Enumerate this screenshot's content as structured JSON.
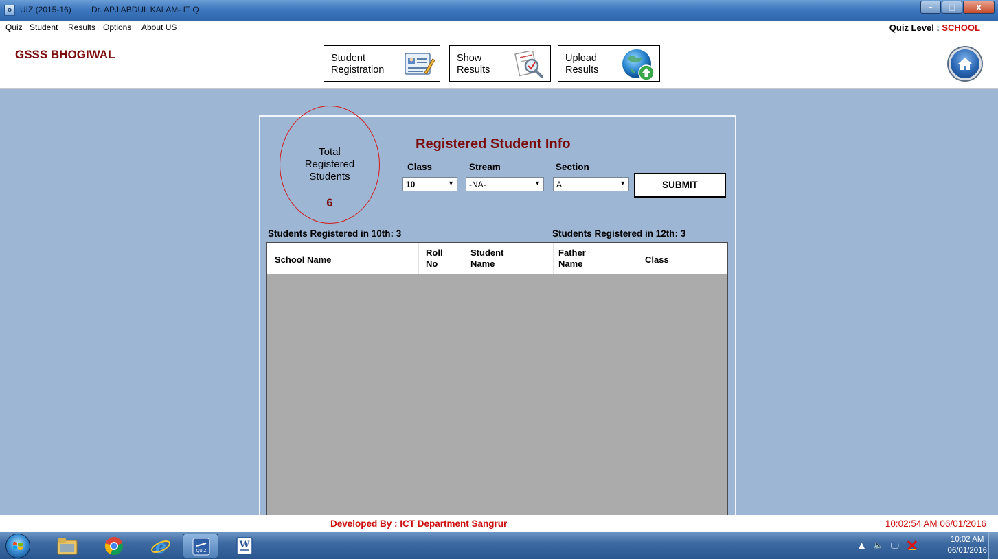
{
  "window": {
    "title_app": "UIZ (2015-16)",
    "title_caption": "Dr. APJ ABDUL KALAM- IT Q",
    "minimize_glyph": "–",
    "maximize_glyph": "□",
    "close_glyph": "x"
  },
  "menu": {
    "items": [
      "Quiz",
      "Student",
      "Results",
      "Options",
      "About US"
    ],
    "quiz_level_label": "Quiz Level :",
    "quiz_level_value": "SCHOOL"
  },
  "header": {
    "school_name": "GSSS BHOGIWAL",
    "student_registration": "Student\nRegistration",
    "show_results": "Show\nResults",
    "upload_results": "Upload\nResults"
  },
  "panel": {
    "total_label": "Total\nRegistered\nStudents",
    "total_count": "6",
    "title": "Registered Student Info",
    "class_label": "Class",
    "class_value": "10",
    "stream_label": "Stream",
    "stream_value": "-NA-",
    "section_label": "Section",
    "section_value": "A",
    "submit_label": "SUBMIT",
    "count_10th": "Students Registered in 10th: 3",
    "count_12th": "Students Registered in 12th: 3"
  },
  "grid": {
    "columns": [
      "School Name",
      "Roll\nNo",
      "Student\nName",
      "Father\nName",
      "Class"
    ],
    "rows": []
  },
  "footer": {
    "developed_by": "Developed By :  ICT Department Sangrur",
    "clock": "10:02:54 AM  06/01/2016"
  },
  "taskbar": {
    "quiz_app_label": "QUIZ",
    "word_app_label": "W",
    "tray_time": "10:02 AM",
    "tray_date": "06/01/2016"
  },
  "colors": {
    "accent_maroon": "#7a0c0c",
    "accent_red": "#cc1010",
    "panel_blue": "#9db6d4",
    "grid_gray": "#ababab"
  }
}
